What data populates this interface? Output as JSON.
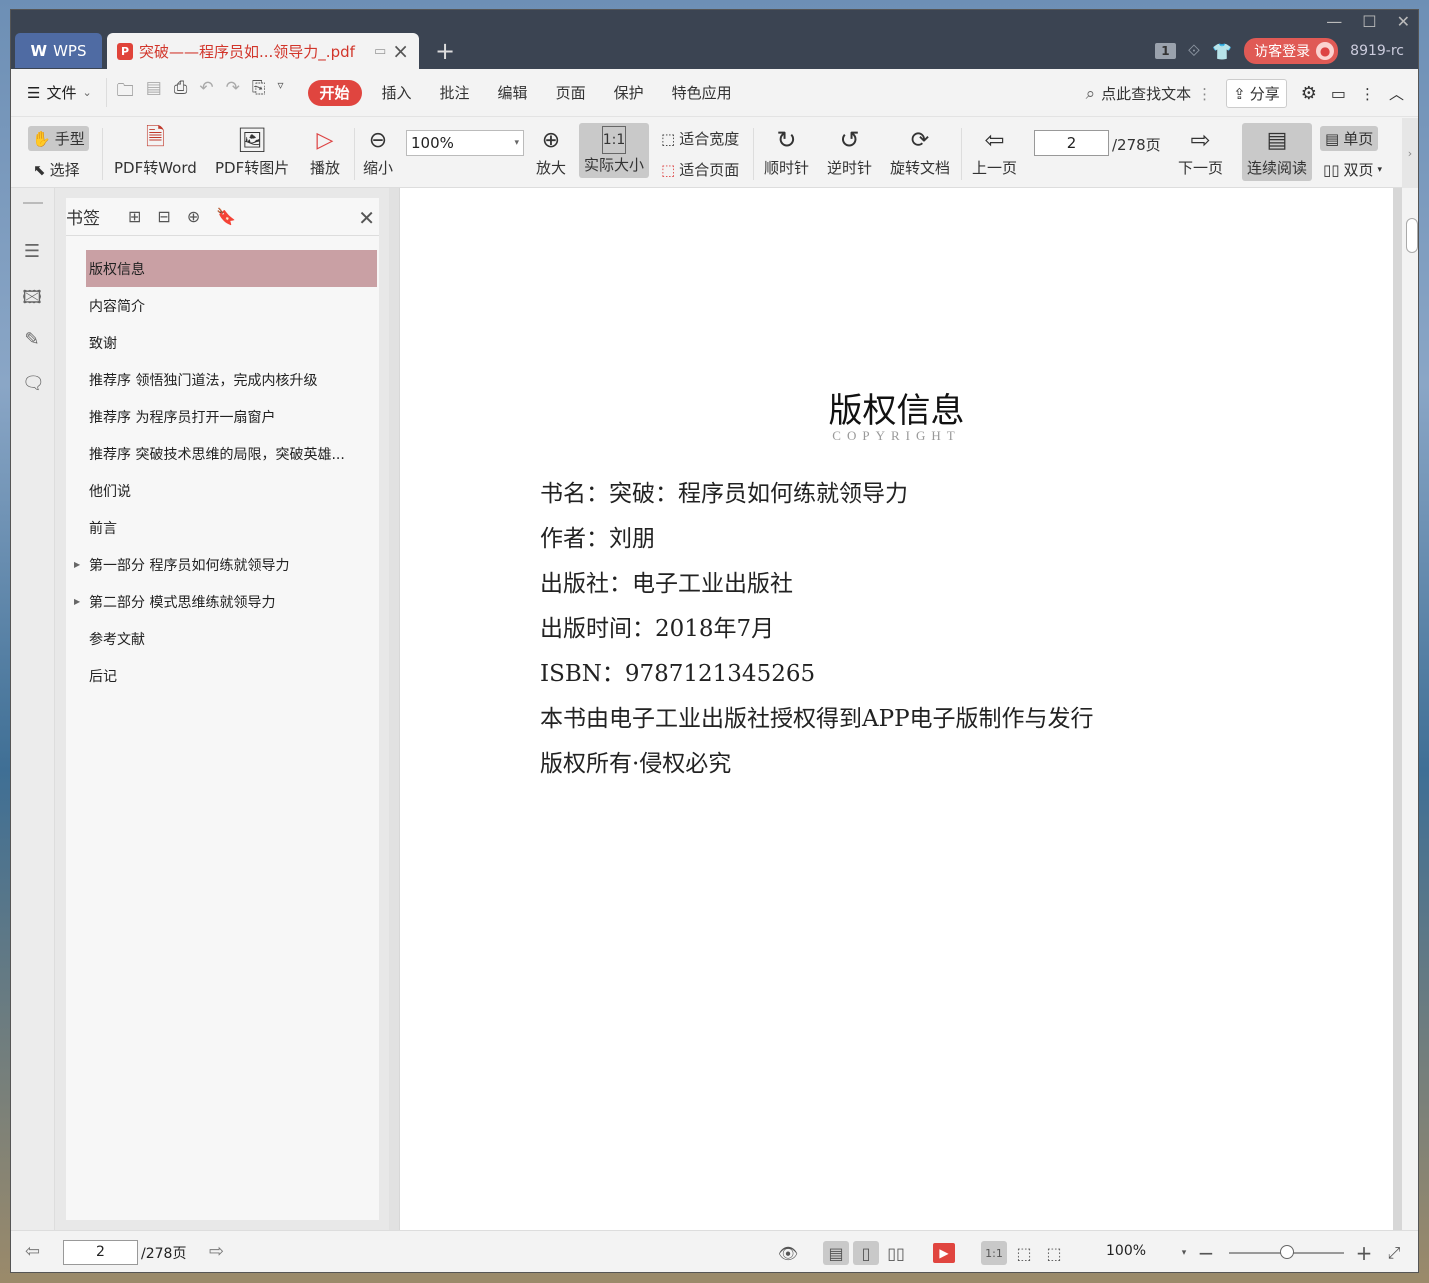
{
  "titlebar": {
    "app_tab": "WPS",
    "doc_tab": "突破——程序员如...领导力_.pdf",
    "new_tab": "+",
    "badge": "1",
    "login": "访客登录",
    "version": "8919-rc"
  },
  "menubar": {
    "file": "文件",
    "tabs": [
      "开始",
      "插入",
      "批注",
      "编辑",
      "页面",
      "保护",
      "特色应用"
    ],
    "search": "点此查找文本",
    "share": "分享"
  },
  "ribbon": {
    "hand": "手型",
    "select": "选择",
    "pdf_to_word": "PDF转Word",
    "pdf_to_image": "PDF转图片",
    "play": "播放",
    "zoom_out": "缩小",
    "zoom_value": "100%",
    "zoom_in": "放大",
    "actual_size": "实际大小",
    "fit_width": "适合宽度",
    "fit_page": "适合页面",
    "rotate_cw": "顺时针",
    "rotate_ccw": "逆时针",
    "rotate_doc": "旋转文档",
    "prev_page": "上一页",
    "current_page": "2",
    "total_pages": "/278页",
    "next_page": "下一页",
    "continuous": "连续阅读",
    "single": "单页",
    "double": "双页"
  },
  "bookmarks": {
    "title": "书签",
    "items": [
      {
        "label": "版权信息"
      },
      {
        "label": "内容简介"
      },
      {
        "label": "致谢"
      },
      {
        "label": "推荐序 领悟独门道法，完成内核升级"
      },
      {
        "label": "推荐序 为程序员打开一扇窗户"
      },
      {
        "label": "推荐序 突破技术思维的局限，突破英雄..."
      },
      {
        "label": "他们说"
      },
      {
        "label": "前言"
      },
      {
        "label": "第一部分 程序员如何练就领导力"
      },
      {
        "label": "第二部分 模式思维练就领导力"
      },
      {
        "label": "参考文献"
      },
      {
        "label": "后记"
      }
    ]
  },
  "document": {
    "title": "版权信息",
    "subtitle": "COPYRIGHT",
    "lines": [
      "书名：突破：程序员如何练就领导力",
      "作者：刘朋",
      "出版社：电子工业出版社",
      "出版时间：2018年7月",
      "ISBN：9787121345265",
      "本书由电子工业出版社授权得到APP电子版制作与发行",
      "版权所有·侵权必究"
    ]
  },
  "statusbar": {
    "page": "2",
    "total": "/278页",
    "zoom": "100%",
    "zoom_level": 0.5
  }
}
